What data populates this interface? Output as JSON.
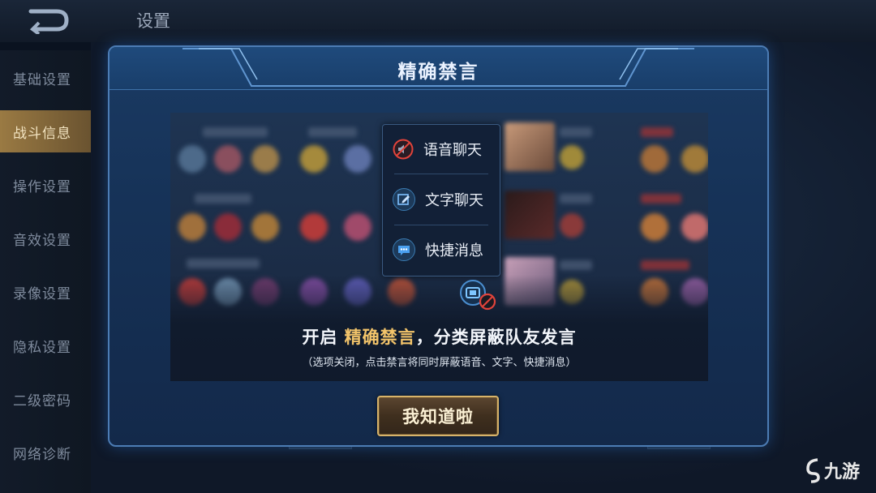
{
  "background": {
    "title": "设置",
    "sidebar": [
      {
        "label": "基础设置",
        "active": false
      },
      {
        "label": "战斗信息",
        "active": true
      },
      {
        "label": "操作设置",
        "active": false
      },
      {
        "label": "音效设置",
        "active": false
      },
      {
        "label": "录像设置",
        "active": false
      },
      {
        "label": "隐私设置",
        "active": false
      },
      {
        "label": "二级密码",
        "active": false
      },
      {
        "label": "网络诊断",
        "active": false
      }
    ]
  },
  "modal": {
    "title": "精确禁言",
    "chat_menu": [
      {
        "label": "语音聊天",
        "icon": "muted-speaker-icon"
      },
      {
        "label": "文字聊天",
        "icon": "pencil-icon"
      },
      {
        "label": "快捷消息",
        "icon": "chat-bubble-icon"
      }
    ],
    "headline_prefix": "开启 ",
    "headline_highlight": "精确禁言",
    "headline_suffix": "，分类屏蔽队友发言",
    "subline": "（选项关闭，点击禁言将同时屏蔽语音、文字、快捷消息）",
    "confirm_label": "我知道啦"
  },
  "watermark": "九游",
  "colors": {
    "accent_gold": "#d7b36a",
    "highlight": "#f3c46a",
    "modal_border": "#4c7cb4",
    "mute_red": "#e0433b"
  }
}
